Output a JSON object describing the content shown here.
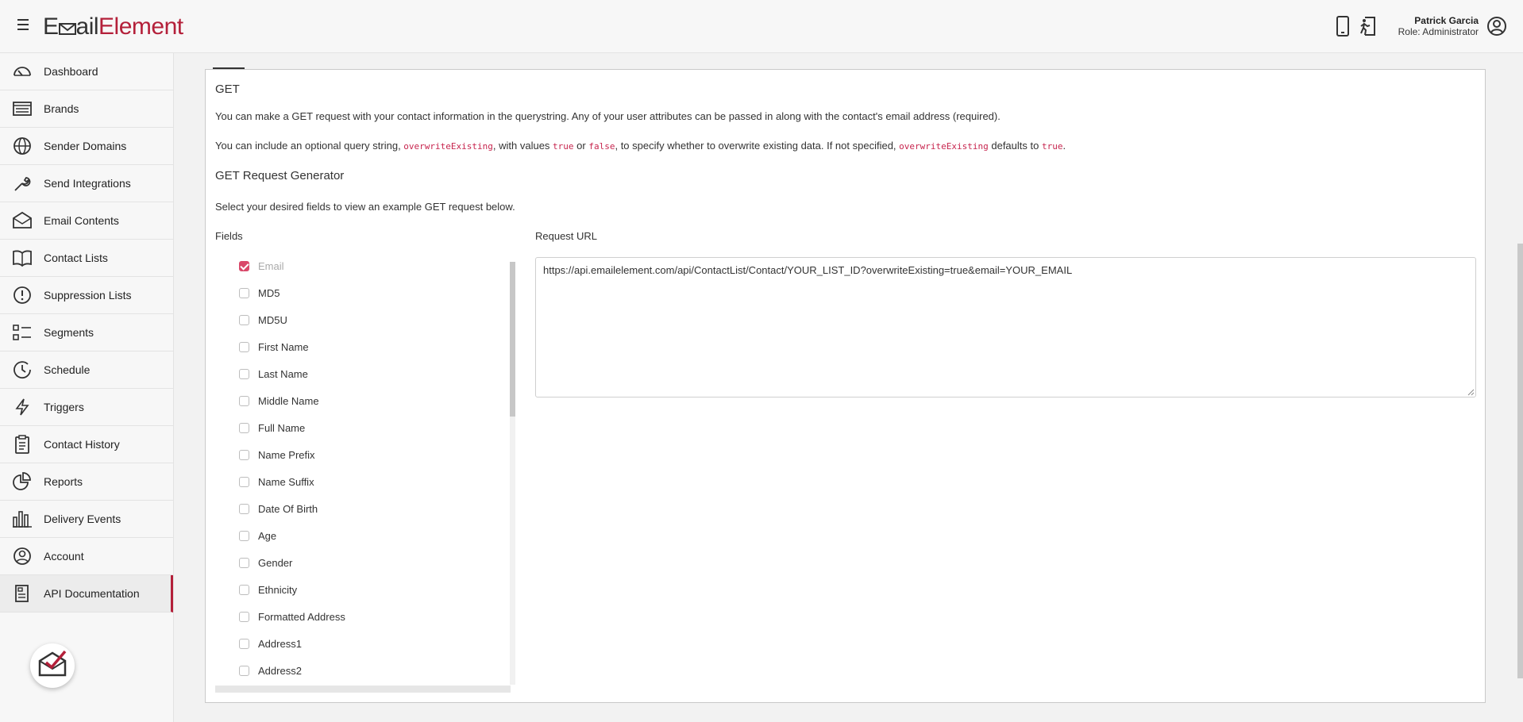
{
  "header": {
    "logo_part1": "E",
    "logo_part2": "ail",
    "logo_part3": "Element",
    "user_name": "Patrick Garcia",
    "user_role": "Role: Administrator"
  },
  "colors": {
    "brand": "#b4203a",
    "code": "#c7254e",
    "checkbox": "#d9486a"
  },
  "sidebar": {
    "items": [
      {
        "label": "Dashboard",
        "icon": "gauge-icon"
      },
      {
        "label": "Brands",
        "icon": "list-card-icon"
      },
      {
        "label": "Sender Domains",
        "icon": "globe-icon"
      },
      {
        "label": "Send Integrations",
        "icon": "wrench-icon"
      },
      {
        "label": "Email Contents",
        "icon": "envelope-icon"
      },
      {
        "label": "Contact Lists",
        "icon": "book-icon"
      },
      {
        "label": "Suppression Lists",
        "icon": "alert-circle-icon"
      },
      {
        "label": "Segments",
        "icon": "segments-icon"
      },
      {
        "label": "Schedule",
        "icon": "clock-icon"
      },
      {
        "label": "Triggers",
        "icon": "bolt-icon"
      },
      {
        "label": "Contact History",
        "icon": "clipboard-icon"
      },
      {
        "label": "Reports",
        "icon": "pie-chart-icon"
      },
      {
        "label": "Delivery Events",
        "icon": "bar-chart-icon"
      },
      {
        "label": "Account",
        "icon": "user-circle-icon"
      },
      {
        "label": "API Documentation",
        "icon": "document-icon"
      }
    ]
  },
  "main": {
    "section_title": "GET",
    "para1": "You can make a GET request with your contact information in the querystring. Any of your user attributes can be passed in along with the contact's email address (required).",
    "para2_a": "You can include an optional query string, ",
    "para2_code1": "overwriteExisting",
    "para2_b": ", with values ",
    "para2_code2": "true",
    "para2_c": " or ",
    "para2_code3": "false",
    "para2_d": ", to specify whether to overwrite existing data. If not specified, ",
    "para2_code4": "overwriteExisting",
    "para2_e": " defaults to ",
    "para2_code5": "true",
    "para2_f": ".",
    "generator_title": "GET Request Generator",
    "generator_desc": "Select your desired fields to view an example GET request below.",
    "fields_label": "Fields",
    "request_url_label": "Request URL",
    "request_url": "https://api.emailelement.com/api/ContactList/Contact/YOUR_LIST_ID?overwriteExisting=true&email=YOUR_EMAIL",
    "fields": [
      {
        "label": "Email",
        "checked": true,
        "disabled": true
      },
      {
        "label": "MD5",
        "checked": false
      },
      {
        "label": "MD5U",
        "checked": false
      },
      {
        "label": "First Name",
        "checked": false
      },
      {
        "label": "Last Name",
        "checked": false
      },
      {
        "label": "Middle Name",
        "checked": false
      },
      {
        "label": "Full Name",
        "checked": false
      },
      {
        "label": "Name Prefix",
        "checked": false
      },
      {
        "label": "Name Suffix",
        "checked": false
      },
      {
        "label": "Date Of Birth",
        "checked": false
      },
      {
        "label": "Age",
        "checked": false
      },
      {
        "label": "Gender",
        "checked": false
      },
      {
        "label": "Ethnicity",
        "checked": false
      },
      {
        "label": "Formatted Address",
        "checked": false
      },
      {
        "label": "Address1",
        "checked": false
      },
      {
        "label": "Address2",
        "checked": false
      }
    ]
  }
}
